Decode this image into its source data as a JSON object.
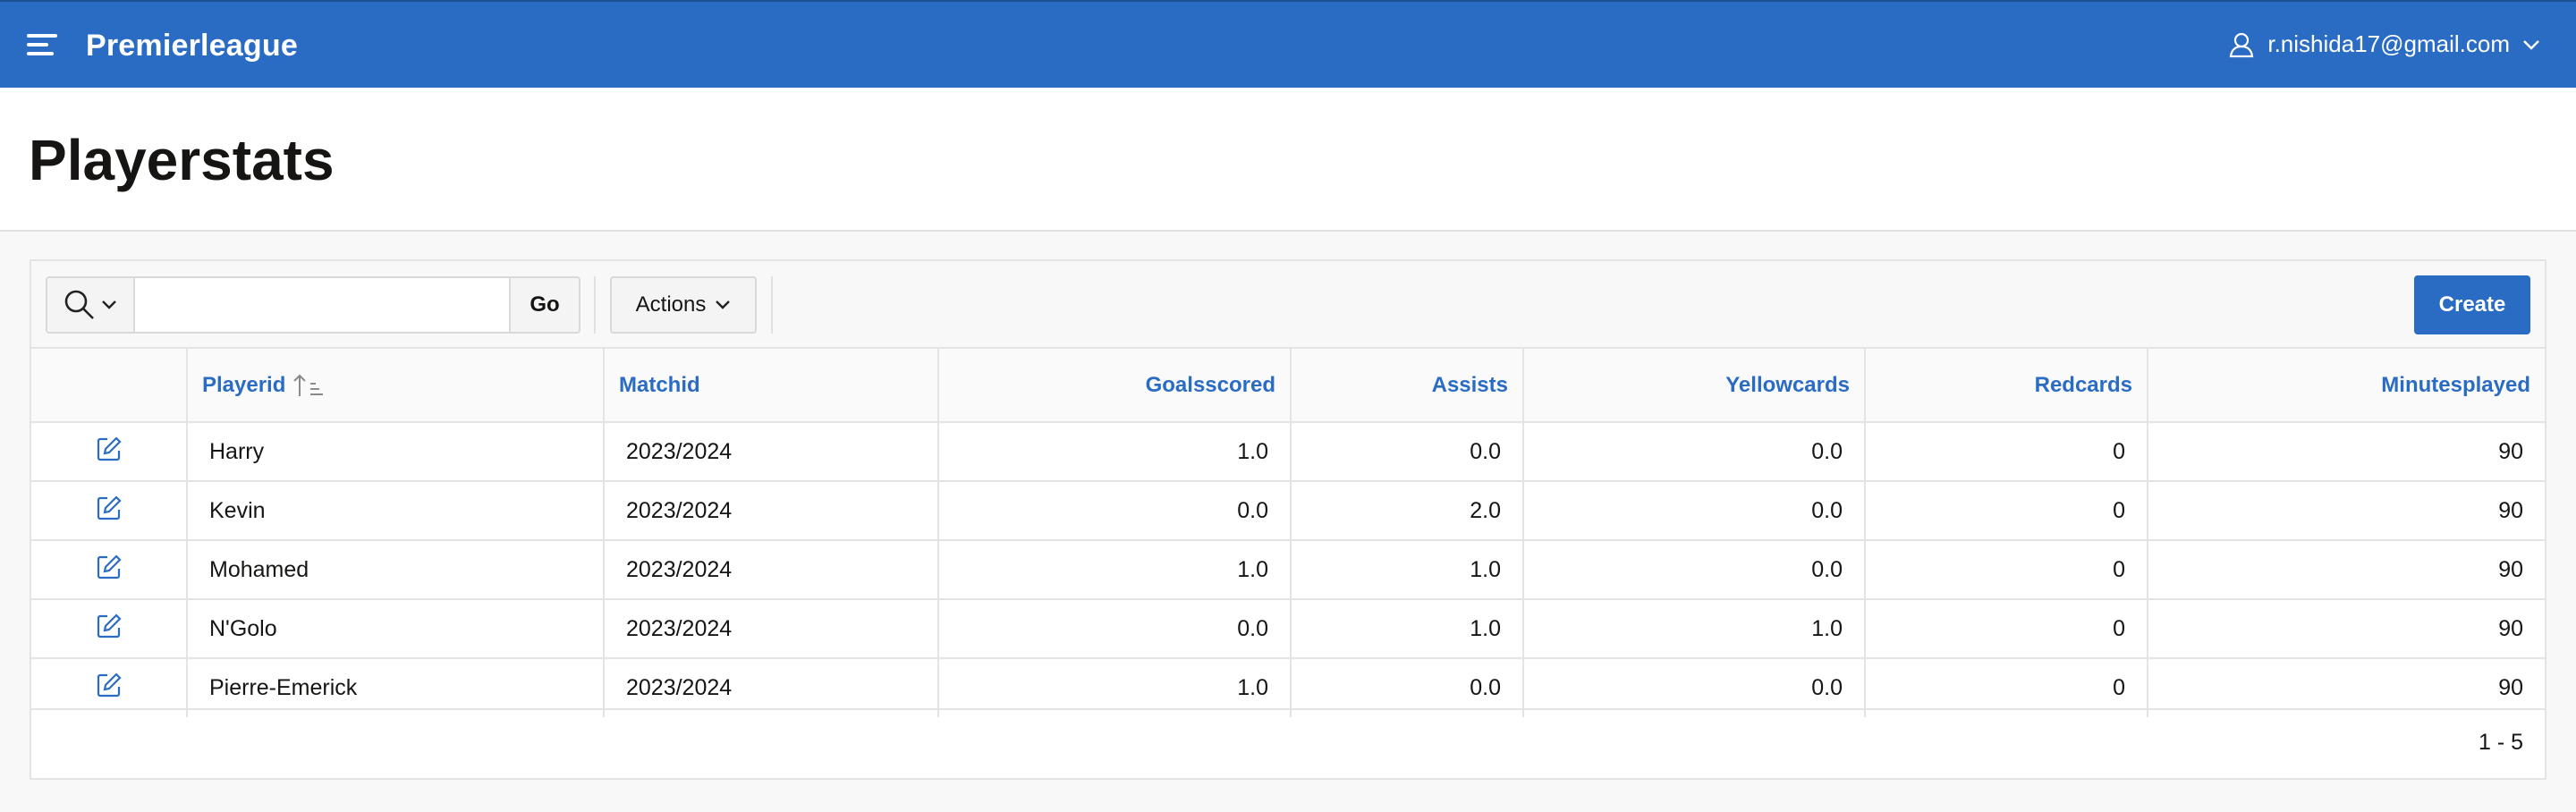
{
  "header": {
    "app_title": "Premierleague",
    "user_email": "r.nishida17@gmail.com",
    "accent_color": "#2a6cc4"
  },
  "page": {
    "title": "Playerstats"
  },
  "toolbar": {
    "search_value": "",
    "go_label": "Go",
    "actions_label": "Actions",
    "create_label": "Create"
  },
  "table": {
    "columns": [
      "Playerid",
      "Matchid",
      "Goalsscored",
      "Assists",
      "Yellowcards",
      "Redcards",
      "Minutesplayed"
    ],
    "sorted_column": "Playerid",
    "sort_direction": "ascending",
    "rows": [
      [
        "Harry",
        "2023/2024",
        "1.0",
        "0.0",
        "0.0",
        "0",
        "90"
      ],
      [
        "Kevin",
        "2023/2024",
        "0.0",
        "2.0",
        "0.0",
        "0",
        "90"
      ],
      [
        "Mohamed",
        "2023/2024",
        "1.0",
        "1.0",
        "0.0",
        "0",
        "90"
      ],
      [
        "N'Golo",
        "2023/2024",
        "0.0",
        "1.0",
        "1.0",
        "0",
        "90"
      ],
      [
        "Pierre-Emerick",
        "2023/2024",
        "1.0",
        "0.0",
        "0.0",
        "0",
        "90"
      ]
    ]
  },
  "pagination": {
    "range": "1 - 5"
  },
  "icons": [
    "menu-icon",
    "user-icon",
    "chevron-down-icon",
    "search-icon",
    "sort-ascending-icon",
    "edit-icon"
  ]
}
